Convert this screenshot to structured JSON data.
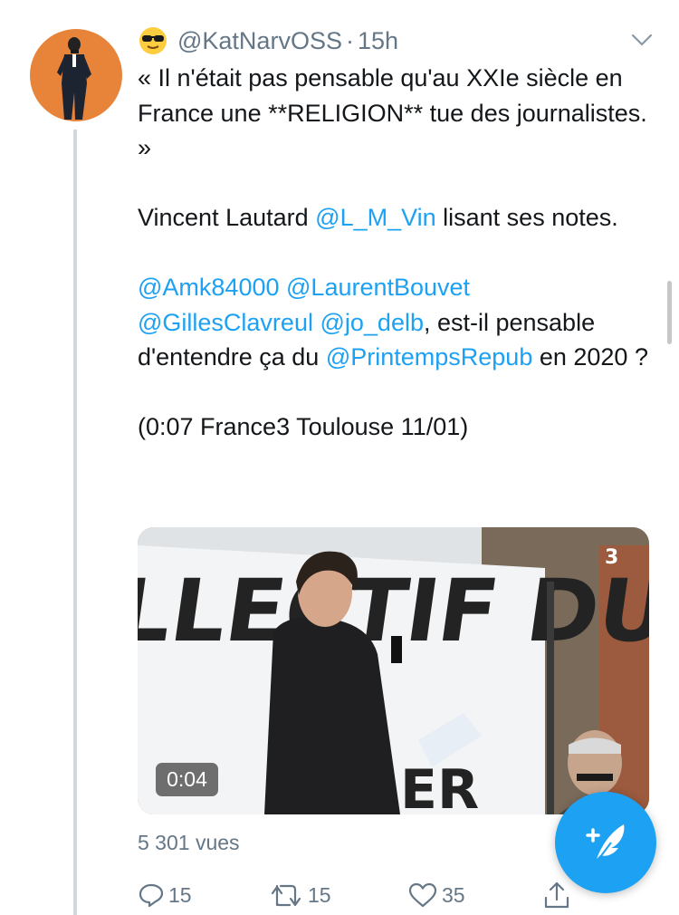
{
  "tweet": {
    "handle": "@KatNarvOSS",
    "separator": "·",
    "time": "15h",
    "emoji_icon": "sunglasses-face-emoji",
    "quote_line": "« Il n'était pas pensable qu'au XXIe siècle en France une **RELIGION** tue des journalistes. »",
    "p2_before": "Vincent Lautard ",
    "p2_mention": "@L_M_Vin",
    "p2_after": " lisant ses notes.",
    "p3_m1": "@Amk84000",
    "p3_m2": "@LaurentBouvet",
    "p3_m3": "@GillesClavreul",
    "p3_m4": "@jo_delb",
    "p3_text1": ", est-il pensable d'entendre ça du ",
    "p3_m5": "@PrintempsRepub",
    "p3_text2": " en 2020 ?",
    "p4": "(0:07 France3 Toulouse 11/01)",
    "media": {
      "duration": "0:04",
      "banner_text": "LLECTIF DU",
      "banner_text2": "ER",
      "channel_logo": "3"
    },
    "views": "5 301 vues",
    "actions": {
      "reply_count": "15",
      "retweet_count": "15",
      "like_count": "35"
    }
  },
  "colors": {
    "link": "#1da1f2",
    "muted": "#657786",
    "avatar_bg": "#e8833a",
    "fab": "#1da1f2"
  }
}
